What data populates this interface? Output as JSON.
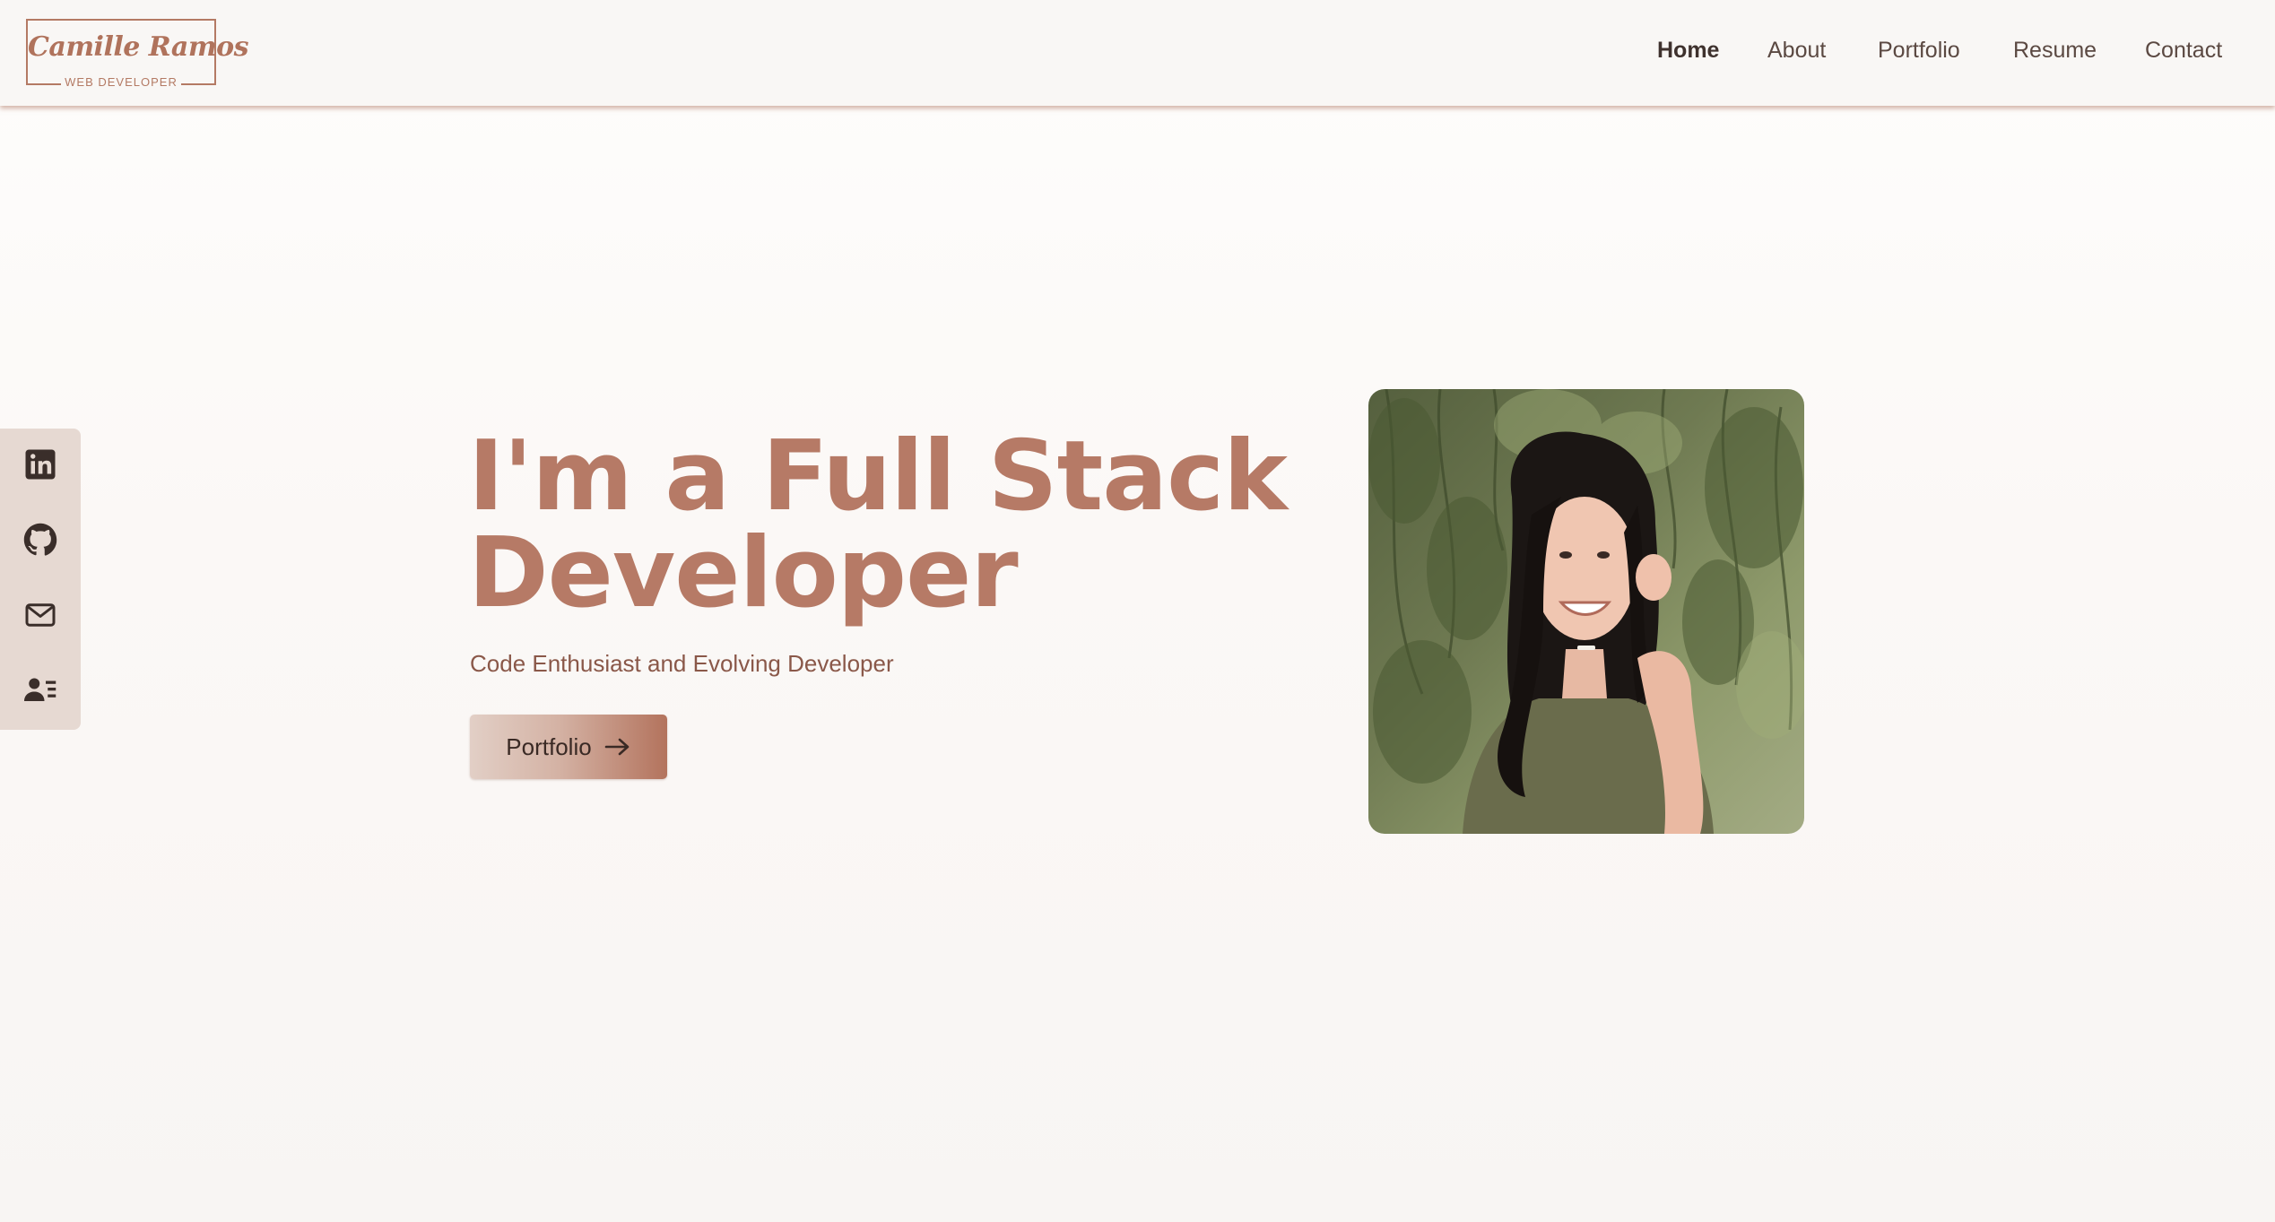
{
  "header": {
    "logo": {
      "name": "Camille Ramos",
      "tagline": "WEB DEVELOPER"
    },
    "nav": [
      {
        "label": "Home",
        "active": true
      },
      {
        "label": "About",
        "active": false
      },
      {
        "label": "Portfolio",
        "active": false
      },
      {
        "label": "Resume",
        "active": false
      },
      {
        "label": "Contact",
        "active": false
      }
    ]
  },
  "sidebar": {
    "links": [
      {
        "icon": "linkedin-icon"
      },
      {
        "icon": "github-icon"
      },
      {
        "icon": "mail-icon"
      },
      {
        "icon": "contact-card-icon"
      }
    ]
  },
  "hero": {
    "title": "I'm a Full Stack Developer",
    "subtitle": "Code Enthusiast and Evolving Developer",
    "cta_label": "Portfolio",
    "cta_icon": "arrow-right-icon",
    "portrait": "photo of a smiling woman with long dark hair in an olive t-shirt in front of willow branches"
  },
  "colors": {
    "accent": "#b67a66",
    "header_bg": "#f9f7f5",
    "sidebar_bg": "#e6d9d2",
    "text_dark": "#3f322e",
    "subtitle": "#8a5849"
  }
}
